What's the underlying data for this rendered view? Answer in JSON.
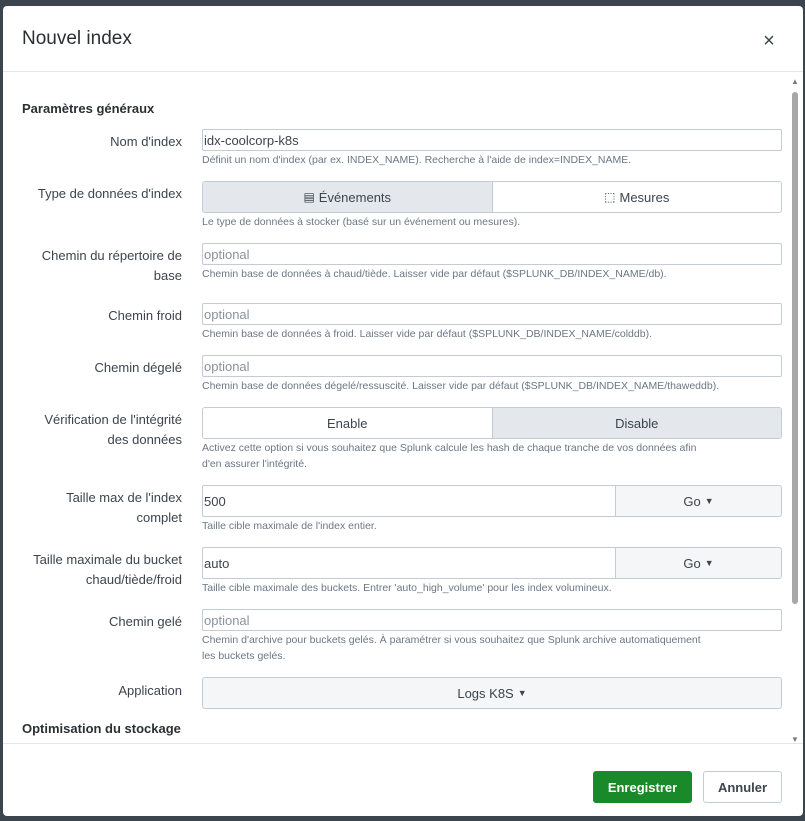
{
  "dialog": {
    "title": "Nouvel index",
    "close_icon": "×"
  },
  "sections": {
    "general": "Paramètres généraux",
    "storage": "Optimisation du stockage"
  },
  "fields": {
    "index_name": {
      "label": "Nom d'index",
      "value": "idx-coolcorp-k8s",
      "help": "Définit un nom d'index (par ex. INDEX_NAME). Recherche à l'aide de index=INDEX_NAME."
    },
    "data_type": {
      "label": "Type de données d'index",
      "options": [
        "Événements",
        "Mesures"
      ],
      "icons": [
        "document-icon",
        "ruler-icon"
      ],
      "selected": "Événements",
      "help": "Le type de données à stocker (basé sur un événement ou mesures)."
    },
    "home_path": {
      "label_line1": "Chemin du répertoire de",
      "label_line2": "base",
      "placeholder": "optional",
      "help": "Chemin base de données à chaud/tiède. Laisser vide par défaut ($SPLUNK_DB/INDEX_NAME/db)."
    },
    "cold_path": {
      "label": "Chemin froid",
      "placeholder": "optional",
      "help": "Chemin base de données à froid. Laisser vide par défaut ($SPLUNK_DB/INDEX_NAME/colddb)."
    },
    "thawed_path": {
      "label": "Chemin dégelé",
      "placeholder": "optional",
      "help": "Chemin base de données dégelé/ressuscité. Laisser vide par défaut ($SPLUNK_DB/INDEX_NAME/thaweddb)."
    },
    "integrity": {
      "label_line1": "Vérification de l'intégrité",
      "label_line2": "des données",
      "options": [
        "Enable",
        "Disable"
      ],
      "selected": "Disable",
      "help_line1": "Activez cette option si vous souhaitez que Splunk calcule les hash de chaque tranche de vos données afin",
      "help_line2": "d'en assurer l'intégrité."
    },
    "max_index_size": {
      "label_line1": "Taille max de l'index",
      "label_line2": "complet",
      "value": "500",
      "unit": "Go",
      "help": "Taille cible maximale de l'index entier."
    },
    "max_bucket_size": {
      "label_line1": "Taille maximale du bucket",
      "label_line2": "chaud/tiède/froid",
      "value": "auto",
      "unit": "Go",
      "help": "Taille cible maximale des buckets. Entrer 'auto_high_volume' pour les index volumineux."
    },
    "frozen_path": {
      "label": "Chemin gelé",
      "placeholder": "optional",
      "help_line1": "Chemin d'archive pour buckets gelés. À paramétrer si vous souhaitez que Splunk archive automatiquement",
      "help_line2": "les buckets gelés."
    },
    "application": {
      "label": "Application",
      "value": "Logs K8S"
    }
  },
  "footer": {
    "save_label": "Enregistrer",
    "cancel_label": "Annuler"
  },
  "colors": {
    "primary": "#1a8929",
    "overlay": "#3c444d",
    "active_segment": "#e4e8ec"
  }
}
